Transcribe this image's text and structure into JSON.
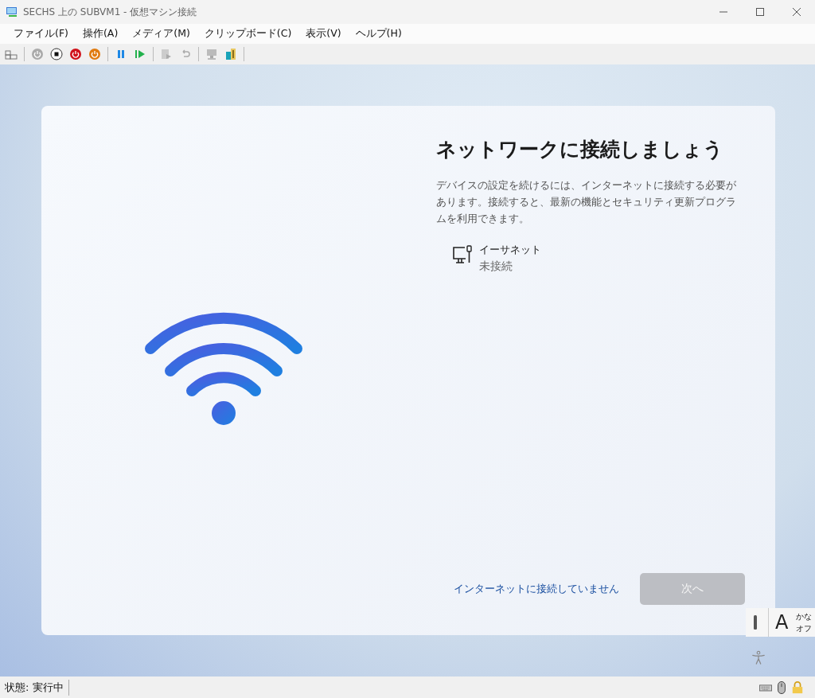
{
  "window": {
    "title": "SECHS 上の SUBVM1  - 仮想マシン接続"
  },
  "menu": [
    "ファイル(F)",
    "操作(A)",
    "メディア(M)",
    "クリップボード(C)",
    "表示(V)",
    "ヘルプ(H)"
  ],
  "setup": {
    "heading": "ネットワークに接続しましょう",
    "description": "デバイスの設定を続けるには、インターネットに接続する必要があります。接続すると、最新の機能とセキュリティ更新プログラムを利用できます。",
    "networks": [
      {
        "name": "イーサネット",
        "status": "未接続"
      }
    ],
    "skip_link": "インターネットに接続していません",
    "next_button": {
      "label": "次へ",
      "disabled": true
    }
  },
  "ime": {
    "mode": "A",
    "line_1": "かな",
    "line_2": "オフ"
  },
  "status_bar": {
    "text": "状態: 実行中"
  }
}
